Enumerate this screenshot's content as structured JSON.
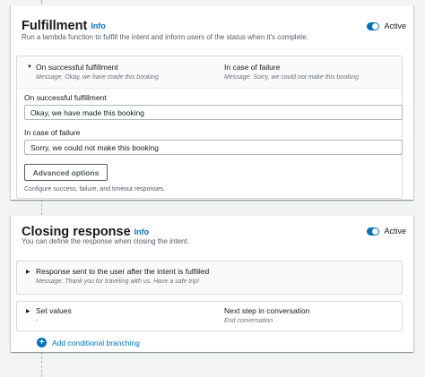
{
  "fulfillment": {
    "title": "Fulfillment",
    "info": "Info",
    "description": "Run a lambda function to fulfill the intent and inform users of the status when it's complete.",
    "toggle_label": "Active",
    "success_header": "On successful fulfillment",
    "success_message": "Message: Okay, we have made this booking",
    "failure_header": "In case of failure",
    "failure_message": "Message: Sorry, we could not make this booking",
    "success_field_label": "On successful fulfillment",
    "success_field_value": "Okay, we have made this booking",
    "failure_field_label": "In case of failure",
    "failure_field_value": "Sorry, we could not make this booking",
    "advanced_button": "Advanced options",
    "advanced_desc": "Configure success, failure, and timeout responses."
  },
  "closing": {
    "title": "Closing response",
    "info": "Info",
    "description": "You can define the response when closing the intent.",
    "toggle_label": "Active",
    "response_header": "Response sent to the user after the intent is fulfilled",
    "response_message": "Message: Thank you for traveling with us. Have a safe trip!",
    "set_values_label": "Set values",
    "set_values_value": "-",
    "next_step_label": "Next step in conversation",
    "next_step_value": "End conversation",
    "add_branching": "Add conditional branching"
  },
  "icons": {
    "caret_down": "caret-down-icon",
    "caret_right": "caret-right-icon",
    "plus": "plus-circle-icon"
  },
  "colors": {
    "accent": "#0073bb",
    "text": "#16191f",
    "muted": "#687078",
    "background": "#f2f3f3"
  }
}
